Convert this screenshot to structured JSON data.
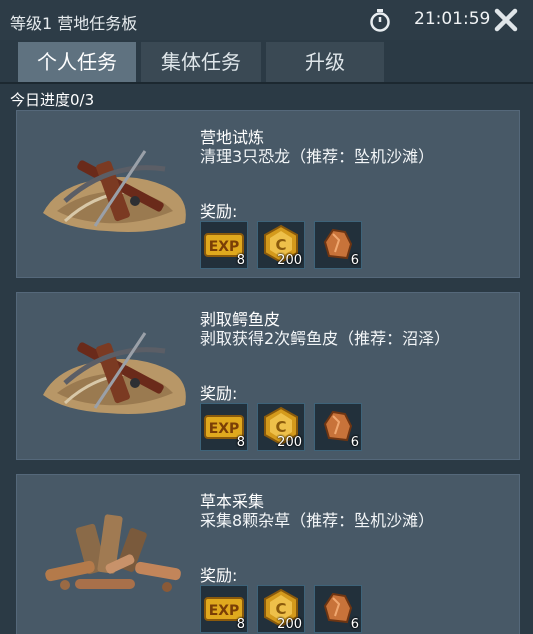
{
  "header": {
    "title": "等级1 营地任务板",
    "time": "21:01:59",
    "timer_icon": "stopwatch-icon",
    "close_icon": "close-icon"
  },
  "tabs": [
    {
      "label": "个人任务",
      "active": true
    },
    {
      "label": "集体任务",
      "active": false
    },
    {
      "label": "升级",
      "active": false
    }
  ],
  "progress_text": "今日进度0/3",
  "tasks": [
    {
      "title": "营地试炼",
      "description": "清理3只恐龙（推荐：坠机沙滩）",
      "image_icon": "crossbow-icon",
      "reward_label": "奖励:",
      "rewards": [
        {
          "icon": "exp-icon",
          "count": "8"
        },
        {
          "icon": "coin-icon",
          "count": "200"
        },
        {
          "icon": "copper-ore-icon",
          "count": "6"
        }
      ]
    },
    {
      "title": "剥取鳄鱼皮",
      "description": "剥取获得2次鳄鱼皮（推荐：沼泽）",
      "image_icon": "crossbow-icon",
      "reward_label": "奖励:",
      "rewards": [
        {
          "icon": "exp-icon",
          "count": "8"
        },
        {
          "icon": "coin-icon",
          "count": "200"
        },
        {
          "icon": "copper-ore-icon",
          "count": "6"
        }
      ]
    },
    {
      "title": "草本采集",
      "description": "采集8颗杂草（推荐：坠机沙滩）",
      "image_icon": "wood-logs-icon",
      "reward_label": "奖励:",
      "rewards": [
        {
          "icon": "exp-icon",
          "count": "8"
        },
        {
          "icon": "coin-icon",
          "count": "200"
        },
        {
          "icon": "copper-ore-icon",
          "count": "6"
        }
      ]
    }
  ],
  "colors": {
    "background": "#2b3a45",
    "card": "#485967",
    "tab_active": "#5f7280",
    "tab_inactive": "#3a4954",
    "reward_slot": "#22303b",
    "exp_gold": "#e0a91e",
    "coin_gold": "#d49a1c",
    "copper": "#c8733a"
  }
}
